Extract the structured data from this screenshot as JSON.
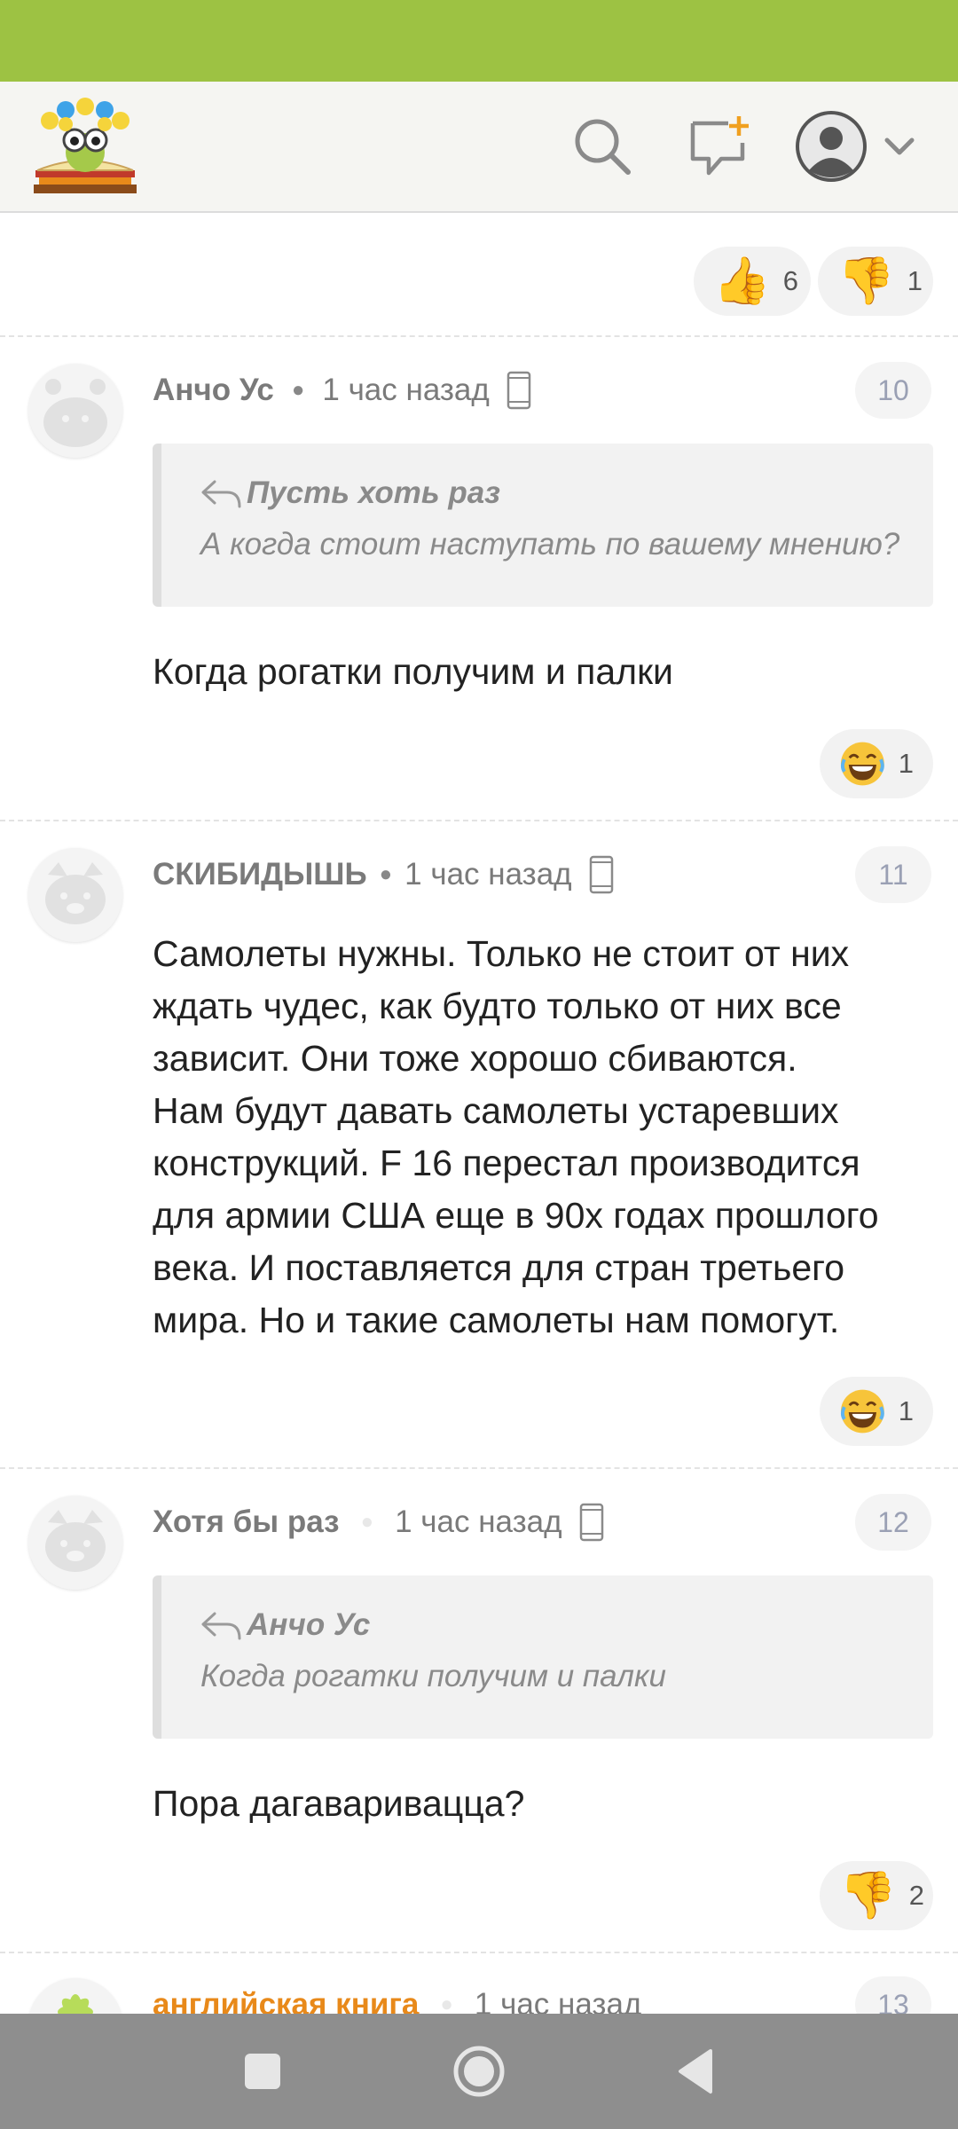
{
  "top_reactions": {
    "like_count": "6",
    "dislike_count": "1"
  },
  "comments": [
    {
      "author": "Анчо Ус",
      "time": "1 час назад",
      "number": "10",
      "quote": {
        "author": "Пусть хоть раз",
        "text": "А когда стоит наступать по вашему мнению?"
      },
      "text": "Когда рогатки получим и палки",
      "reaction": {
        "icon": "laughing-emoji",
        "count": "1"
      }
    },
    {
      "author": "СКИБИДЫШЬ",
      "time": "1 час назад",
      "number": "11",
      "text_lines": [
        "Самолеты нужны. Только не стоит от них",
        "ждать чудес, как будто только от них все",
        "зависит. Они тоже хорошо сбиваются.",
        "Нам будут давать самолеты устаревших",
        "конструкций. F 16 перестал производится",
        "для армии США еще в 90х годах прошлого",
        "века. И поставляется для стран третьего",
        "мира. Но и такие самолеты нам помогут."
      ],
      "reaction": {
        "icon": "laughing-emoji",
        "count": "1"
      }
    },
    {
      "author": "Хотя бы раз",
      "time": "1 час назад",
      "number": "12",
      "quote": {
        "author": "Анчо Ус",
        "text": "Когда рогатки получим и палки"
      },
      "text": "Пора дагавариваццa?",
      "reaction": {
        "icon": "thumbs-down-emoji",
        "count": "2"
      }
    },
    {
      "author": "английская книга",
      "time": "1 час назад",
      "number": "13"
    }
  ],
  "colors": {
    "status_bar": "#9dc243",
    "accent_author": "#e8891a",
    "nav_bar": "#8e8e8e"
  }
}
